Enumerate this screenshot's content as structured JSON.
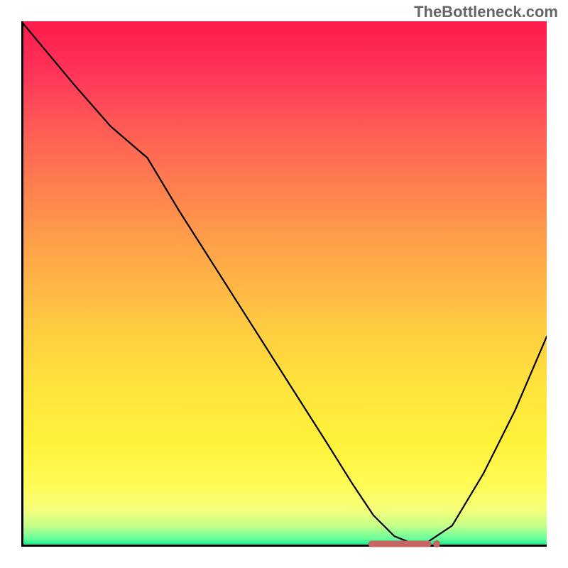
{
  "watermark": "TheBottleneck.com",
  "chart_data": {
    "type": "line",
    "title": "",
    "xlabel": "",
    "ylabel": "",
    "xlim": [
      0,
      100
    ],
    "ylim": [
      0,
      100
    ],
    "grid": false,
    "legend": false,
    "background": "red-yellow-green-vertical-gradient",
    "series": [
      {
        "name": "bottleneck-curve",
        "color": "#000000",
        "x": [
          0,
          5,
          10,
          17,
          24,
          30,
          37,
          44,
          51,
          58,
          63,
          67,
          71,
          76,
          82,
          88,
          94,
          100
        ],
        "values": [
          100,
          94,
          88,
          80,
          74,
          64,
          53,
          42,
          31,
          20,
          12,
          6,
          2,
          0,
          4,
          14,
          26,
          40
        ]
      }
    ],
    "optimum_marker": {
      "x_start": 66,
      "x_end": 78,
      "y": 0,
      "color": "#c86464"
    }
  }
}
